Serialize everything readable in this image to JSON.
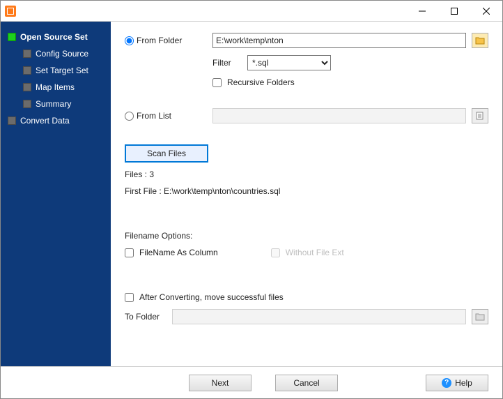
{
  "sidebar": {
    "items": [
      {
        "label": "Open Source Set"
      },
      {
        "label": "Config Source"
      },
      {
        "label": "Set Target Set"
      },
      {
        "label": "Map Items"
      },
      {
        "label": "Summary"
      },
      {
        "label": "Convert Data"
      }
    ]
  },
  "source": {
    "from_folder_label": "From Folder",
    "folder_path": "E:\\work\\temp\\nton",
    "filter_label": "Filter",
    "filter_value": "*.sql",
    "recursive_label": "Recursive Folders",
    "from_list_label": "From List",
    "list_path": "",
    "scan_label": "Scan Files",
    "files_count_label": "Files : 3",
    "first_file_label": "First File : E:\\work\\temp\\nton\\countries.sql"
  },
  "filename_opts": {
    "heading": "Filename Options:",
    "as_column": "FileName As Column",
    "without_ext": "Without File Ext"
  },
  "after": {
    "move_label": "After Converting, move successful files",
    "to_folder_label": "To Folder",
    "to_folder_path": ""
  },
  "buttons": {
    "next": "Next",
    "cancel": "Cancel",
    "help": "Help"
  }
}
